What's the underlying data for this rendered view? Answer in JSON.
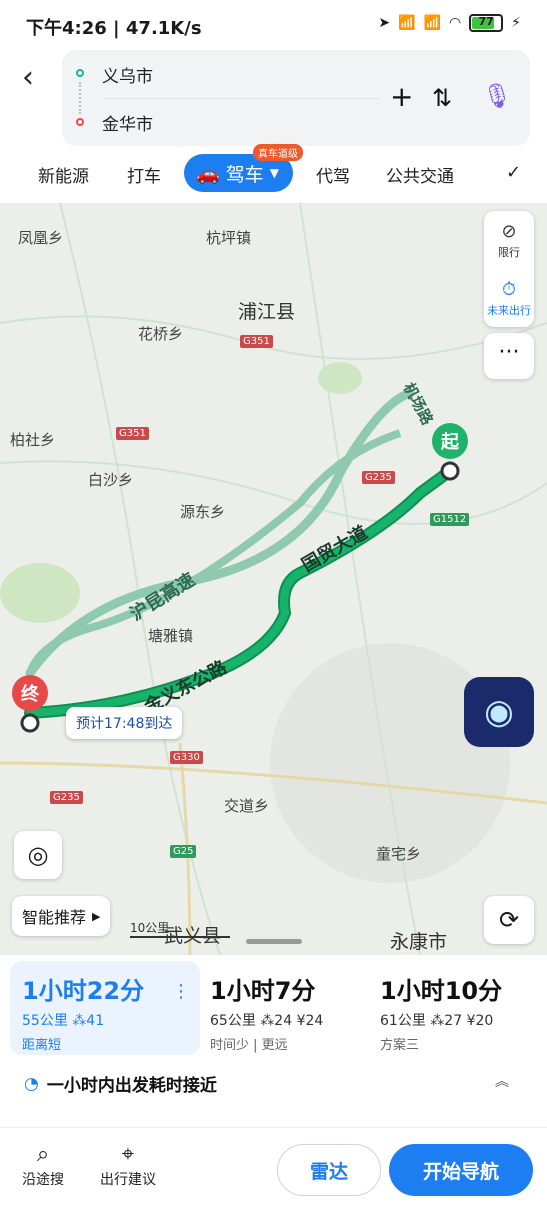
{
  "status_bar": {
    "time": "下午4:26",
    "speed": "47.1K/s",
    "battery": "77"
  },
  "search": {
    "from": "义乌市",
    "to": "金华市"
  },
  "tabs": [
    {
      "label": "新能源"
    },
    {
      "label": "打车"
    },
    {
      "label": "驾车",
      "badge": "真车道级"
    },
    {
      "label": "代驾"
    },
    {
      "label": "公共交通"
    }
  ],
  "map": {
    "labels": [
      "凤凰乡",
      "杭坪镇",
      "浦江县",
      "花桥乡",
      "柏社乡",
      "白沙乡",
      "源东乡",
      "塘雅镇",
      "交道乡",
      "童宅乡",
      "武义县",
      "永康市"
    ],
    "roads": [
      "G351",
      "G351",
      "G235",
      "G1512",
      "G330",
      "G235",
      "G25"
    ],
    "road_names": {
      "hw1": "沪昆高速",
      "hw2": "国贸大道",
      "hw3": "金义东公路",
      "hw4": "机场路"
    },
    "start_pin": "起",
    "end_pin": "终",
    "eta": "预计17:48到达",
    "side": {
      "limit": "限行",
      "future": "未来出行"
    },
    "smart": "智能推荐",
    "scale": "10公里"
  },
  "routes": [
    {
      "time": "1小时22分",
      "distance": "55公里",
      "lights": "41",
      "toll": "",
      "tag": "距离短"
    },
    {
      "time": "1小时7分",
      "distance": "65公里",
      "lights": "24",
      "toll": "¥24",
      "tag": "时间少 | 更远"
    },
    {
      "time": "1小时10分",
      "distance": "61公里",
      "lights": "27",
      "toll": "¥20",
      "tag": "方案三"
    }
  ],
  "tip": "一小时内出发耗时接近",
  "bottom": {
    "along": "沿途搜",
    "advice": "出行建议",
    "radar": "雷达",
    "start_nav": "开始导航"
  },
  "colors": {
    "accent": "#1c7ef0",
    "route": "#16b36a",
    "alt_route": "#8fc9b0"
  }
}
